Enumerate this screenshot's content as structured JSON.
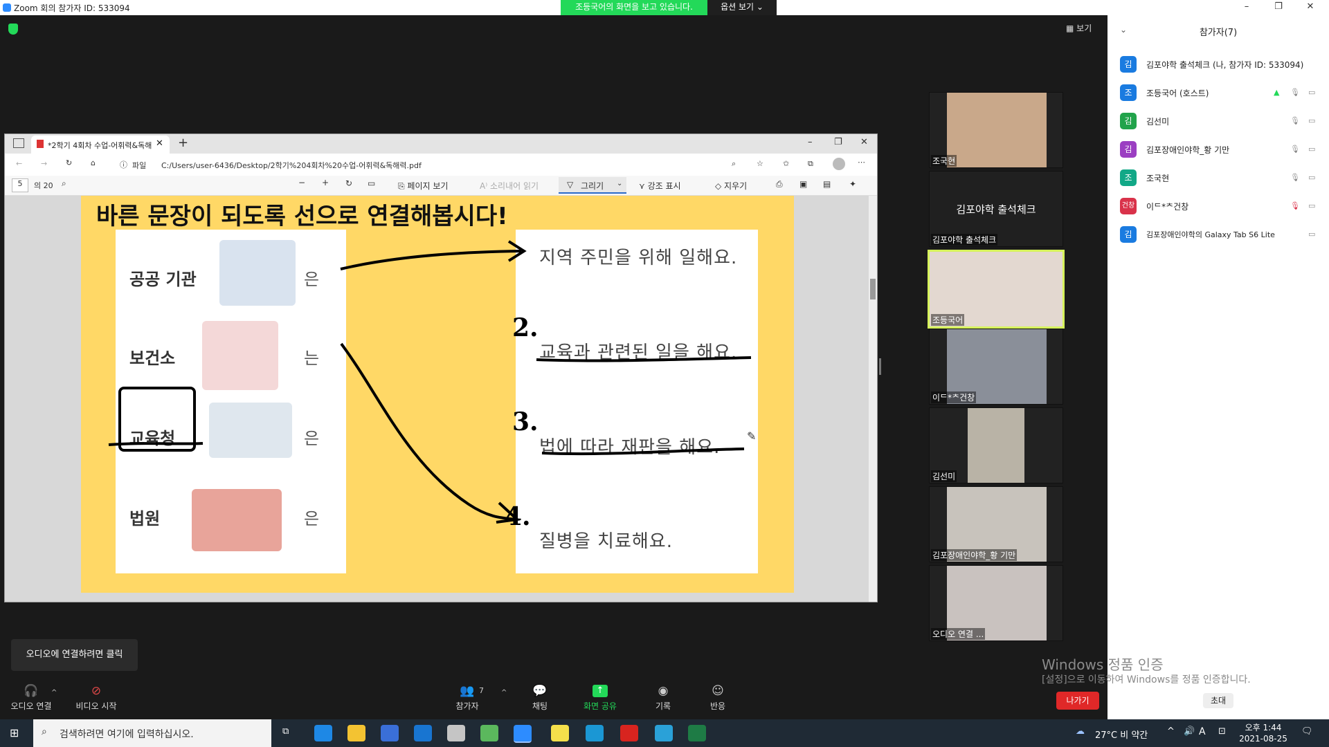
{
  "window": {
    "title": "Zoom 회의 참가자 ID: 533094",
    "share_banner": "조등국어의 화면을 보고 있습니다.",
    "view_options": "옵션 보기 ⌄",
    "view_btn": "보기"
  },
  "browser": {
    "tab_title": "*2학기 4회차 수업-어휘력&독해",
    "file_label": "파일",
    "url": "C:/Users/user-6436/Desktop/2학기%204회차%20수업-어휘력&독해력.pdf",
    "page_current": "5",
    "page_total": "의 20",
    "tb_page_view": "페이지 보기",
    "tb_read_aloud": "소리내어 읽기",
    "tb_draw": "그리기",
    "tb_highlight": "강조 표시",
    "tb_erase": "지우기"
  },
  "worksheet": {
    "heading": "바른 문장이 되도록 선으로 연결해봅시다!",
    "left_items": [
      {
        "word": "공공 기관",
        "particle": "은"
      },
      {
        "word": "보건소",
        "particle": "는"
      },
      {
        "word": "교육청",
        "particle": "은"
      },
      {
        "word": "법원",
        "particle": "은"
      }
    ],
    "right_items": [
      {
        "sentence": "지역 주민을 위해 일해요."
      },
      {
        "sentence": "교육과 관련된 일을 해요."
      },
      {
        "sentence": "법에 따라 재판을 해요."
      },
      {
        "sentence": "질병을 치료해요."
      }
    ],
    "handwritten": [
      "2.",
      "3.",
      "4."
    ]
  },
  "videos": [
    {
      "name": "조국현",
      "color": "#c9a88a"
    },
    {
      "name": "김포야학 출석체크",
      "label": "김포야학 출석체크",
      "color": "#222"
    },
    {
      "name": "조등국어",
      "color": "#d8cfc8"
    },
    {
      "name": "이ᄃ*ᄎ건창",
      "color": "#8a8f99"
    },
    {
      "name": "김선미",
      "color": "#b9b3a6"
    },
    {
      "name": "김포장애인야학_황 기만",
      "color": "#c8c3bc"
    },
    {
      "name": "오디오 연결 ...",
      "color": "#c9c2bf"
    }
  ],
  "participants": {
    "header": "참가자(7)",
    "list": [
      {
        "initial": "김",
        "name": "김포야학 출석체크 (나, 참가자 ID: 533094)",
        "color": "#1a7be0"
      },
      {
        "initial": "조",
        "name": "조등국어 (호스트)",
        "color": "#1a7be0"
      },
      {
        "initial": "김",
        "name": "김선미",
        "color": "#21a34b"
      },
      {
        "initial": "김",
        "name": "김포장애인야학_황 기만",
        "color": "#9b3fc2"
      },
      {
        "initial": "조",
        "name": "조국현",
        "color": "#12a887"
      },
      {
        "initial": "건창",
        "name": "이ᄃ*ᄎ건창",
        "color": "#d9324a"
      },
      {
        "initial": "김",
        "name": "김포장애인야학의 Galaxy Tab S6 Lite",
        "color": "#1a7be0"
      }
    ],
    "invite": "초대"
  },
  "toolbar": {
    "audio_tip": "오디오에 연결하려면 클릭",
    "audio": "오디오 연결",
    "video": "비디오 시작",
    "participants": "참가자",
    "participants_count": "7",
    "chat": "채팅",
    "share": "화면 공유",
    "record": "기록",
    "reactions": "반응",
    "leave": "나가기"
  },
  "watermark": {
    "line1": "Windows 정품 인증",
    "line2": "[설정]으로 이동하여 Windows를 정품 인증합니다."
  },
  "taskbar": {
    "search_placeholder": "검색하려면 여기에 입력하십시오.",
    "weather": "27°C  비 약간",
    "time": "오후 1:44",
    "date": "2021-08-25",
    "lang": "A"
  }
}
